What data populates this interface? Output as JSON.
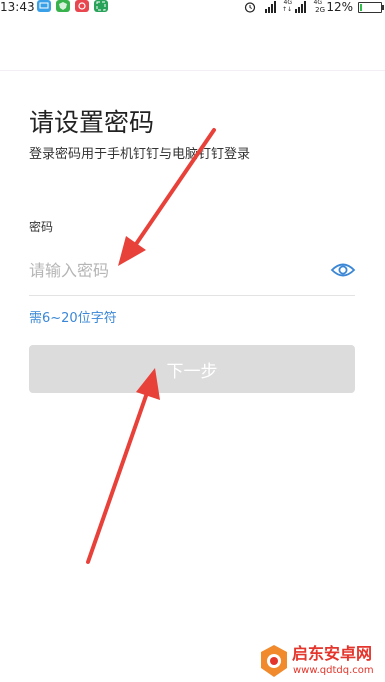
{
  "status_bar": {
    "time": "13:43",
    "net_4g_1": "4G",
    "net_arrows": "↑↓",
    "net_4g_2": "4G",
    "net_2g": "2G",
    "battery_percent": "12%",
    "battery_level": 0.12,
    "app_icons": [
      "message-app-icon",
      "shield-app-icon",
      "weibo-app-icon",
      "scan-app-icon"
    ]
  },
  "screen": {
    "title": "请设置密码",
    "subtitle": "登录密码用于手机钉钉与电脑钉钉登录",
    "password_field": {
      "label": "密码",
      "placeholder": "请输入密码",
      "value": ""
    },
    "hint": "需6~20位字符",
    "next_button_label": "下一步"
  },
  "annotations": {
    "arrow_color": "#e8413a"
  },
  "watermark": {
    "brand": "启东安卓网",
    "url": "www.qdtdq.com"
  },
  "colors": {
    "accent": "#3b87d6",
    "button_disabled": "#dcdcdc",
    "placeholder": "#b5b5b5",
    "watermark": "#e3352b"
  }
}
